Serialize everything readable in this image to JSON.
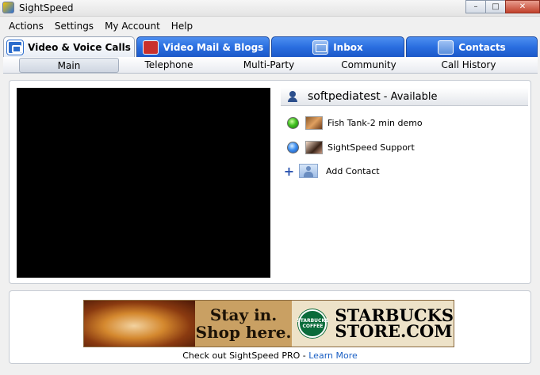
{
  "window": {
    "title": "SightSpeed",
    "controls": {
      "minimize": "–",
      "maximize": "□",
      "close": "✕"
    }
  },
  "menu": [
    "Actions",
    "Settings",
    "My Account",
    "Help"
  ],
  "main_tabs": [
    {
      "label": "Video & Voice Calls",
      "icon": "video-call-icon",
      "active": true
    },
    {
      "label": "Video Mail & Blogs",
      "icon": "video-mail-icon",
      "active": false
    },
    {
      "label": "Inbox",
      "icon": "inbox-icon",
      "active": false
    },
    {
      "label": "Contacts",
      "icon": "contacts-icon",
      "active": false
    }
  ],
  "sub_tabs": [
    {
      "label": "Main",
      "active": true
    },
    {
      "label": "Telephone",
      "active": false
    },
    {
      "label": "Multi-Party",
      "active": false
    },
    {
      "label": "Community",
      "active": false
    },
    {
      "label": "Call History",
      "active": false
    }
  ],
  "user": {
    "username": "softpediatest",
    "status": "- Available"
  },
  "contacts": [
    {
      "name": "Fish Tank-2 min demo",
      "status": "green"
    },
    {
      "name": "SightSpeed Support",
      "status": "blue"
    }
  ],
  "add_contact": {
    "label": "Add Contact",
    "icon": "plus-icon"
  },
  "ad": {
    "line1": "Stay in.",
    "line2": "Shop here.",
    "brand_line1": "STARBUCKS",
    "brand_line2": "STORE.COM",
    "seal_text": "STARBUCKS COFFEE"
  },
  "promo": {
    "text": "Check out SightSpeed PRO - ",
    "link": "Learn More"
  },
  "colors": {
    "tab_blue": "#2a6ee0",
    "link_blue": "#1a5fc4",
    "video_bg": "#000000"
  }
}
